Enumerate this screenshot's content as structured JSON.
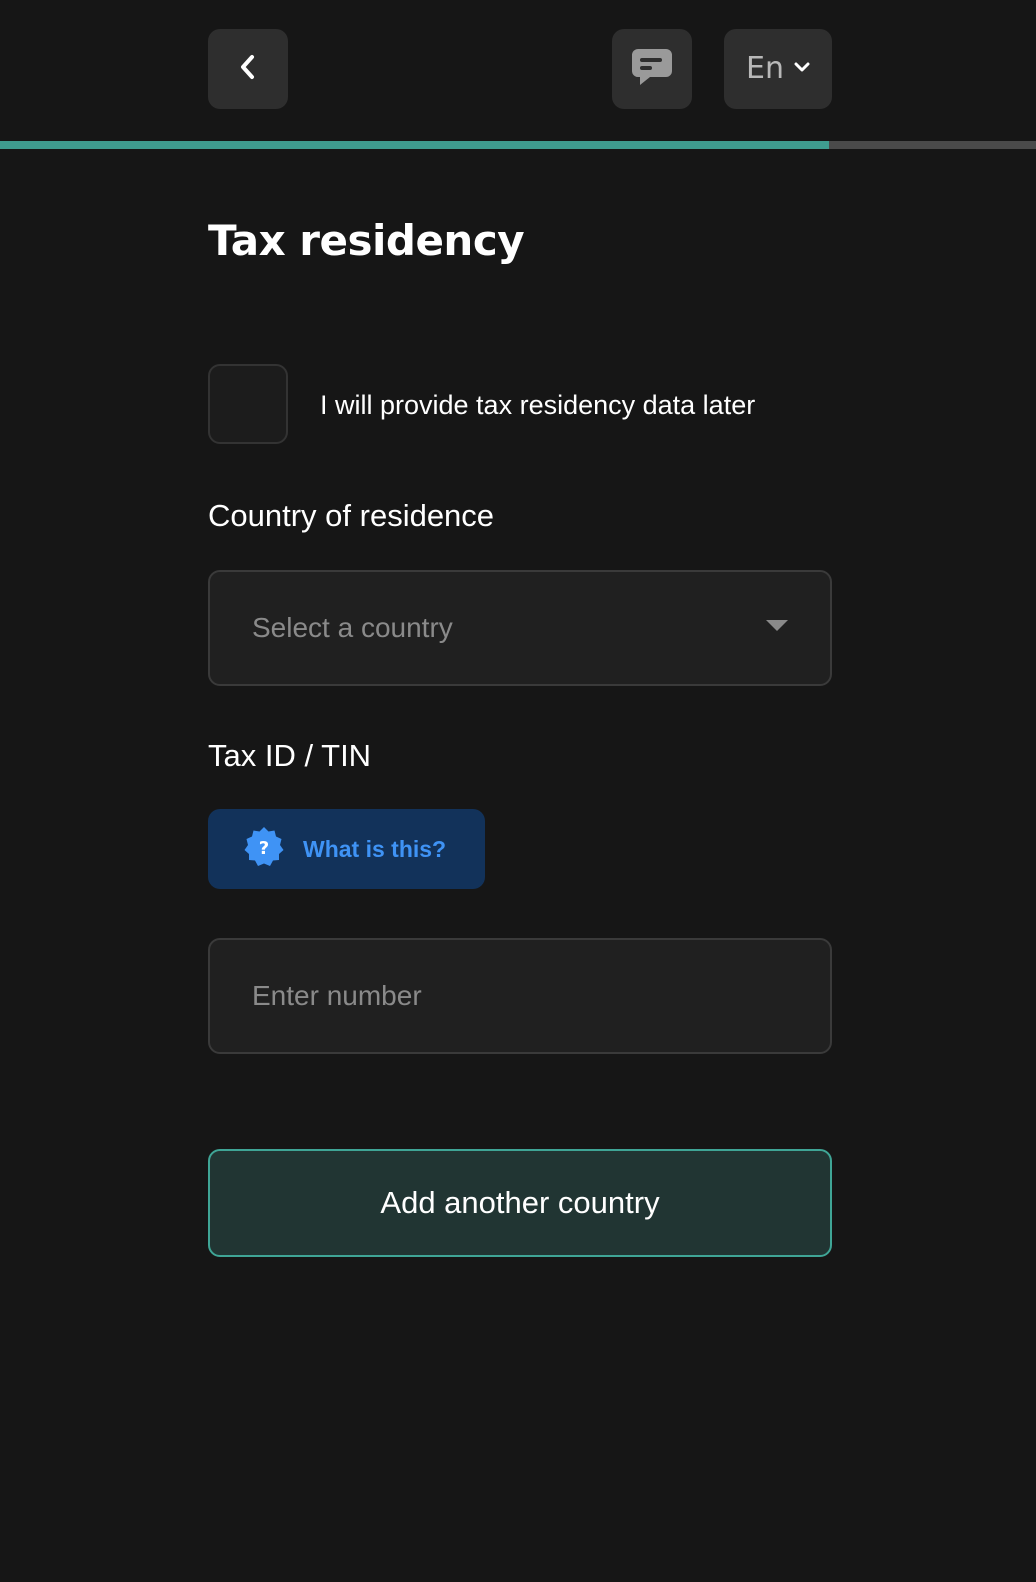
{
  "header": {
    "back_icon": "chevron-left-icon",
    "chat_icon": "chat-bubble-icon",
    "language": "En",
    "language_icon": "chevron-down-icon"
  },
  "progress": {
    "percent": 80,
    "fill_color": "#3f9c8f",
    "track_color": "#4a4a4a"
  },
  "page": {
    "title": "Tax residency"
  },
  "later_option": {
    "label": "I will provide tax residency data later",
    "checked": false
  },
  "country": {
    "label": "Country of residence",
    "placeholder": "Select a country",
    "icon": "caret-down-icon"
  },
  "tax_id": {
    "label": "Tax ID / TIN",
    "help_label": "What is this?",
    "help_icon": "question-badge-icon",
    "placeholder": "Enter number",
    "value": ""
  },
  "actions": {
    "add_country_label": "Add another country"
  },
  "colors": {
    "background": "#161616",
    "accent": "#3fa596",
    "help_bg": "#12325a",
    "help_text": "#3f93f5"
  }
}
